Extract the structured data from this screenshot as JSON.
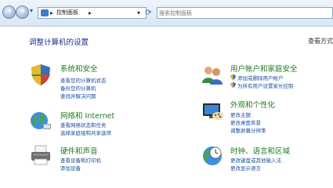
{
  "window": {
    "breadcrumb": "控制面板",
    "search_placeholder": "搜索控制面板"
  },
  "header": {
    "title": "调整计算机的设置",
    "view_by": "查看方式"
  },
  "categories": {
    "system_security": {
      "title": "系统和安全",
      "icon": "shield-icon",
      "links": [
        "查看您的计算机状态",
        "备份您的计算机",
        "查找并解决问题"
      ]
    },
    "user_accounts": {
      "title": "用户帐户和家庭安全",
      "icon": "users-icon",
      "links": [
        "添加或删除用户帐户",
        "为所有用户设置家长控制"
      ]
    },
    "network": {
      "title": "网络和 Internet",
      "icon": "globe-network-icon",
      "links": [
        "查看网络状态和任务",
        "选择家庭组和共享选项"
      ]
    },
    "appearance": {
      "title": "外观和个性化",
      "icon": "monitor-palette-icon",
      "links": [
        "更改主题",
        "更改桌面背景",
        "调整屏幕分辨率"
      ]
    },
    "hardware": {
      "title": "硬件和声音",
      "icon": "printer-icon",
      "links": [
        "查看设备和打印机",
        "添加设备"
      ]
    },
    "clock_region": {
      "title": "时钟、语言和区域",
      "icon": "clock-globe-icon",
      "links": [
        "更改键盘或其他输入法",
        "更改显示语言"
      ]
    }
  },
  "colors": {
    "category_title": "#1f7a1f",
    "link": "#1b4fa0",
    "page_title": "#1e3287"
  }
}
